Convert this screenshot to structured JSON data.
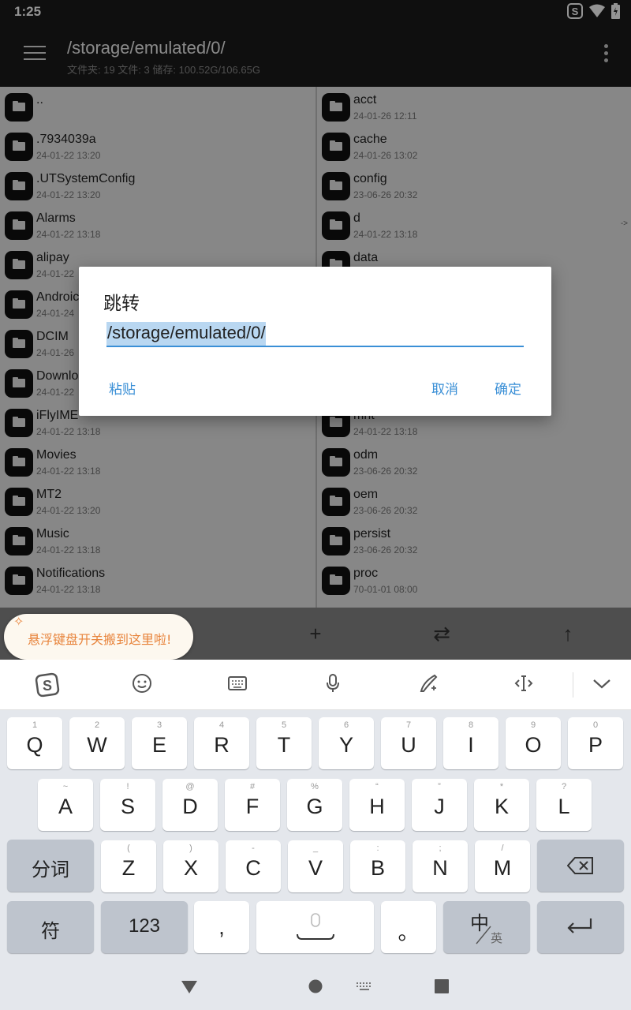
{
  "status": {
    "time": "1:25"
  },
  "appbar": {
    "path": "/storage/emulated/0/",
    "info": "文件夹: 19  文件: 3  储存: 100.52G/106.65G"
  },
  "left_files": [
    {
      "name": "..",
      "date": ""
    },
    {
      "name": ".7934039a",
      "date": "24-01-22 13:20"
    },
    {
      "name": ".UTSystemConfig",
      "date": "24-01-22 13:20"
    },
    {
      "name": "Alarms",
      "date": "24-01-22 13:18"
    },
    {
      "name": "alipay",
      "date": "24-01-22"
    },
    {
      "name": "Androic",
      "date": "24-01-24"
    },
    {
      "name": "DCIM",
      "date": "24-01-26"
    },
    {
      "name": "Downlo",
      "date": "24-01-22"
    },
    {
      "name": "iFlyIME",
      "date": "24-01-22 13:18"
    },
    {
      "name": "Movies",
      "date": "24-01-22 13:18"
    },
    {
      "name": "MT2",
      "date": "24-01-22 13:20"
    },
    {
      "name": "Music",
      "date": "24-01-22 13:18"
    },
    {
      "name": "Notifications",
      "date": "24-01-22 13:18"
    }
  ],
  "right_files": [
    {
      "name": "acct",
      "date": "24-01-26 12:11"
    },
    {
      "name": "cache",
      "date": "24-01-26 13:02"
    },
    {
      "name": "config",
      "date": "23-06-26 20:32"
    },
    {
      "name": "d",
      "date": "24-01-22 13:18",
      "arrow": "->"
    },
    {
      "name": "data",
      "date": ""
    },
    {
      "name": "",
      "date": ""
    },
    {
      "name": "",
      "date": ""
    },
    {
      "name": "",
      "date": ""
    },
    {
      "name": "mnt",
      "date": "24-01-22 13:18"
    },
    {
      "name": "odm",
      "date": "23-06-26 20:32"
    },
    {
      "name": "oem",
      "date": "23-06-26 20:32"
    },
    {
      "name": "persist",
      "date": "23-06-26 20:32"
    },
    {
      "name": "proc",
      "date": "70-01-01 08:00"
    }
  ],
  "toolbar": {
    "add": "+",
    "swap": "⇄",
    "up": "↑"
  },
  "tooltip": {
    "text": "悬浮键盘开关搬到这里啦!"
  },
  "dialog": {
    "title": "跳转",
    "input_value": "/storage/emulated/0/",
    "paste": "粘贴",
    "cancel": "取消",
    "ok": "确定"
  },
  "keyboard": {
    "row1": [
      {
        "sub": "1",
        "main": "Q"
      },
      {
        "sub": "2",
        "main": "W"
      },
      {
        "sub": "3",
        "main": "E"
      },
      {
        "sub": "4",
        "main": "R"
      },
      {
        "sub": "5",
        "main": "T"
      },
      {
        "sub": "6",
        "main": "Y"
      },
      {
        "sub": "7",
        "main": "U"
      },
      {
        "sub": "8",
        "main": "I"
      },
      {
        "sub": "9",
        "main": "O"
      },
      {
        "sub": "0",
        "main": "P"
      }
    ],
    "row2": [
      {
        "sub": "~",
        "main": "A"
      },
      {
        "sub": "!",
        "main": "S"
      },
      {
        "sub": "@",
        "main": "D"
      },
      {
        "sub": "#",
        "main": "F"
      },
      {
        "sub": "%",
        "main": "G"
      },
      {
        "sub": "“",
        "main": "H"
      },
      {
        "sub": "”",
        "main": "J"
      },
      {
        "sub": "*",
        "main": "K"
      },
      {
        "sub": "?",
        "main": "L"
      }
    ],
    "row3": [
      {
        "sub": "(",
        "main": "Z"
      },
      {
        "sub": ")",
        "main": "X"
      },
      {
        "sub": "-",
        "main": "C"
      },
      {
        "sub": "_",
        "main": "V"
      },
      {
        "sub": ":",
        "main": "B"
      },
      {
        "sub": ";",
        "main": "N"
      },
      {
        "sub": "/",
        "main": "M"
      }
    ],
    "fenci": "分词",
    "fu": "符",
    "num": "123",
    "comma": ",",
    "period": "。",
    "zh": "中",
    "en": "英"
  }
}
